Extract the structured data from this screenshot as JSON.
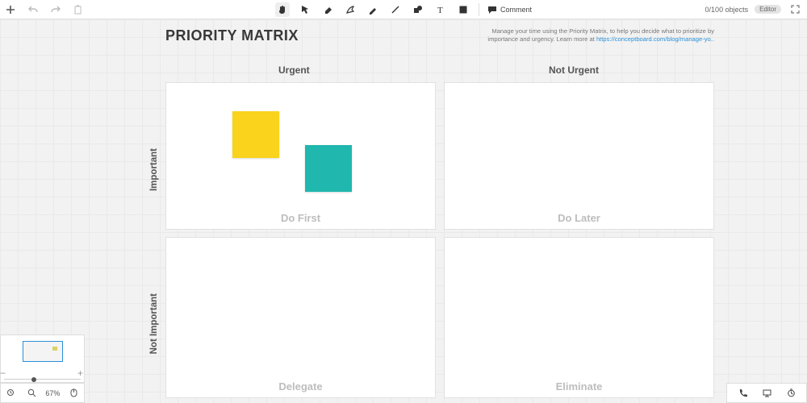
{
  "toolbar": {
    "comment_label": "Comment",
    "object_count": "0/100 objects",
    "role_badge": "Editor"
  },
  "matrix": {
    "title": "PRIORITY MATRIX",
    "description_prefix": "Manage your time using the Priority Matrix, to help you decide what to prioritize by importance and urgency. Learn more at ",
    "description_link": "https://conceptboard.com/blog/manage-yo..",
    "columns": {
      "urgent": "Urgent",
      "not_urgent": "Not Urgent"
    },
    "rows": {
      "important": "Important",
      "not_important": "Not Important"
    },
    "quadrants": {
      "do_first": "Do First",
      "do_later": "Do Later",
      "delegate": "Delegate",
      "eliminate": "Eliminate"
    }
  },
  "zoom": {
    "level": "67%"
  },
  "colors": {
    "note_yellow": "#f9d31c",
    "note_teal": "#1fb7ae",
    "link": "#2a90d9"
  }
}
